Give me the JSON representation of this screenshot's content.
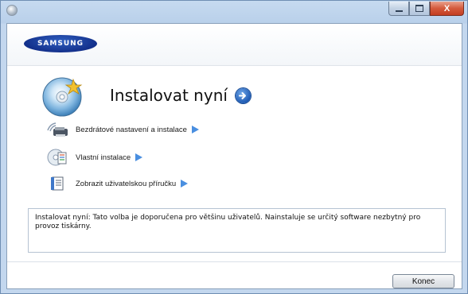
{
  "window": {
    "controls": {
      "minimize": "minimize",
      "maximize": "maximize",
      "close": "X"
    }
  },
  "header": {
    "logo_text": "SAMSUNG"
  },
  "hero": {
    "title": "Instalovat nyní"
  },
  "menu": {
    "items": [
      {
        "label": "Bezdrátové nastavení a instalace",
        "icon": "wireless-setup-icon"
      },
      {
        "label": "Vlastní instalace",
        "icon": "custom-install-icon"
      },
      {
        "label": "Zobrazit uživatelskou příručku",
        "icon": "user-guide-icon"
      }
    ]
  },
  "description": {
    "text": "Instalovat nyní: Tato volba je doporučena pro většinu uživatelů. Nainstaluje se určitý software nezbytný pro provoz tiskárny."
  },
  "footer": {
    "close_label": "Konec"
  },
  "colors": {
    "accent": "#4a8fe0",
    "logo": "#13308b",
    "close_button": "#c33e22"
  }
}
